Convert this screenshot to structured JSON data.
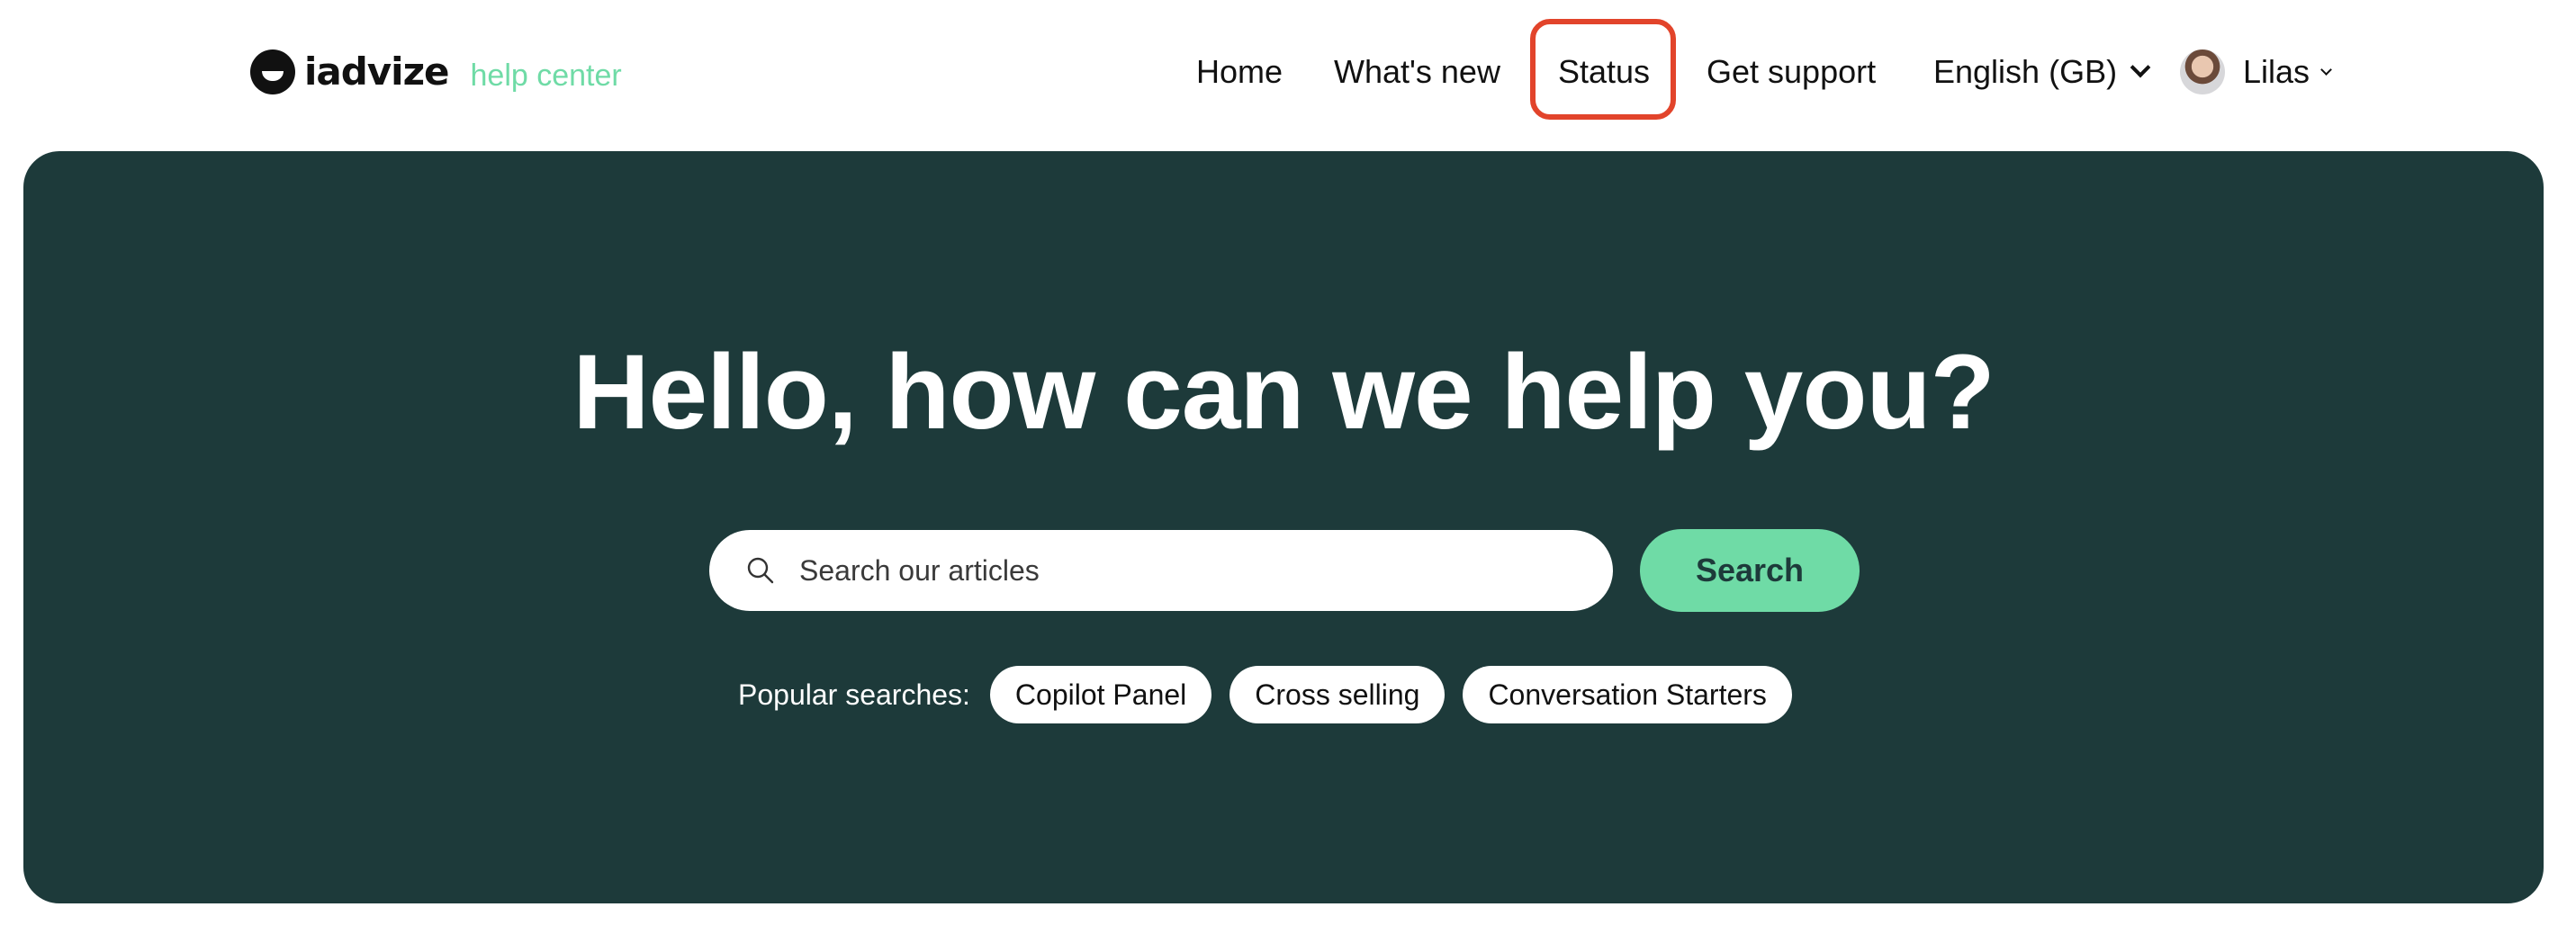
{
  "brand": {
    "logo_text": "iadvize",
    "tagline": "help center",
    "accent_color": "#6fdba6"
  },
  "nav": {
    "home": "Home",
    "whats_new": "What's new",
    "status": "Status",
    "get_support": "Get support",
    "language": "English (GB)",
    "user_name": "Lilas"
  },
  "hero": {
    "title": "Hello, how can we help you?",
    "background_color": "#1d3a3a",
    "search": {
      "placeholder": "Search our articles",
      "value": "",
      "button_label": "Search"
    },
    "popular": {
      "label": "Popular searches:",
      "chips": [
        "Copilot Panel",
        "Cross selling",
        "Conversation Starters"
      ]
    }
  },
  "highlight_color": "#e2442b"
}
